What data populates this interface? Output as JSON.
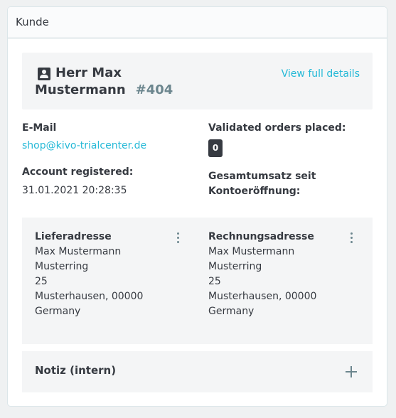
{
  "header": {
    "title": "Kunde"
  },
  "customer": {
    "name_line1": "Herr Max",
    "name_line2": "Mustermann",
    "id": "#404",
    "view_details_label": "View full details"
  },
  "email": {
    "label": "E-Mail",
    "value": "shop@kivo-trialcenter.de"
  },
  "orders": {
    "label": "Validated orders placed:",
    "count": "0"
  },
  "registered": {
    "label": "Account registered:",
    "value": "31.01.2021 20:28:35"
  },
  "revenue": {
    "label_line1": "Gesamtumsatz seit",
    "label_line2": "Kontoeröffnung:"
  },
  "delivery_address": {
    "title": "Lieferadresse",
    "lines": [
      "Max Mustermann",
      "Musterring",
      "25",
      "Musterhausen, 00000",
      "Germany"
    ]
  },
  "invoice_address": {
    "title": "Rechnungsadresse",
    "lines": [
      "Max Mustermann",
      "Musterring",
      "25",
      "Musterhausen, 00000",
      "Germany"
    ]
  },
  "note": {
    "title": "Notiz (intern)"
  },
  "icons": {
    "customer": "person-badge-icon",
    "menu": "kebab-menu-icon",
    "add": "plus-icon"
  },
  "colors": {
    "link": "#25b9d7",
    "text": "#363a41",
    "muted": "#6c868e",
    "panel": "#f4f5f6"
  }
}
